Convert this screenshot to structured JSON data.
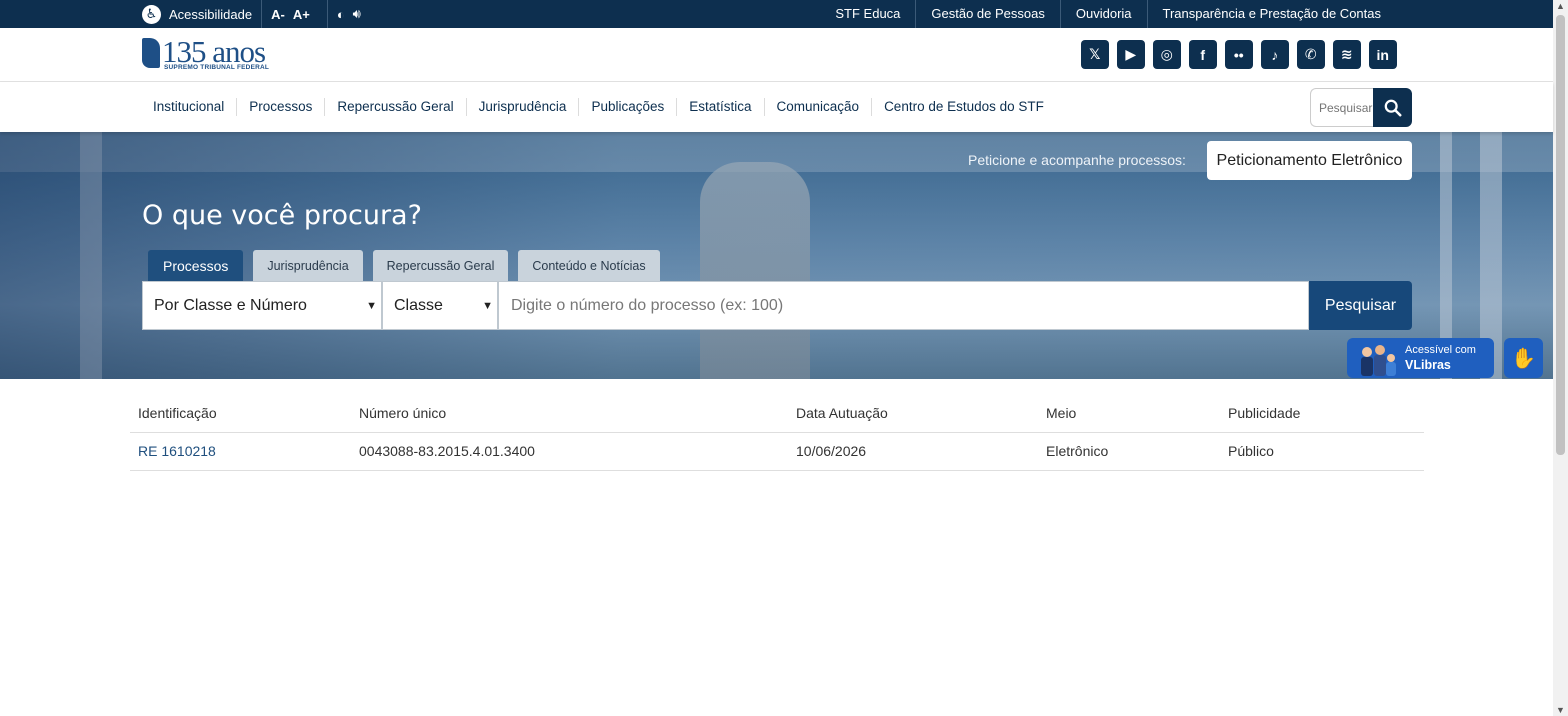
{
  "topbar": {
    "accessibility_label": "Acessibilidade",
    "font_decrease": "A-",
    "font_increase": "A+",
    "contrast_icon": "contrast-icon",
    "audio_icon": "speaker-icon",
    "links": [
      "STF Educa",
      "Gestão de Pessoas",
      "Ouvidoria",
      "Transparência e Prestação de Contas"
    ]
  },
  "header": {
    "logo_number": "135 anos",
    "logo_subtitle": "SUPREMO TRIBUNAL FEDERAL",
    "social": [
      {
        "name": "x-icon",
        "glyph": "𝕏"
      },
      {
        "name": "youtube-icon",
        "glyph": "▶"
      },
      {
        "name": "instagram-icon",
        "glyph": "◎"
      },
      {
        "name": "facebook-icon",
        "glyph": "f"
      },
      {
        "name": "flickr-icon",
        "glyph": "••"
      },
      {
        "name": "tiktok-icon",
        "glyph": "♪"
      },
      {
        "name": "whatsapp-icon",
        "glyph": "✆"
      },
      {
        "name": "spotify-icon",
        "glyph": "≋"
      },
      {
        "name": "linkedin-icon",
        "glyph": "in"
      }
    ]
  },
  "nav": {
    "items": [
      "Institucional",
      "Processos",
      "Repercussão Geral",
      "Jurisprudência",
      "Publicações",
      "Estatística",
      "Comunicação",
      "Centro de Estudos do STF"
    ],
    "search_placeholder": "Pesquisar"
  },
  "hero": {
    "petition_label": "Peticione e acompanhe processos:",
    "petition_button": "Peticionamento Eletrônico",
    "title": "O que você procura?",
    "tabs": [
      "Processos",
      "Jurisprudência",
      "Repercussão Geral",
      "Conteúdo e Notícias"
    ],
    "select_type": "Por Classe e Número",
    "select_class": "Classe",
    "input_placeholder": "Digite o número do processo (ex: 100)",
    "search_button": "Pesquisar"
  },
  "vlibras": {
    "line1": "Acessível com",
    "line2": "VLibras"
  },
  "results": {
    "columns": [
      "Identificação",
      "Número único",
      "Data Autuação",
      "Meio",
      "Publicidade"
    ],
    "rows": [
      [
        "RE 1610218",
        "0043088-83.2015.4.01.3400",
        "10/06/2026",
        "Eletrônico",
        "Público"
      ]
    ]
  },
  "colors": {
    "navy": "#0d2f4f",
    "accent": "#1f4f7e",
    "vlibras": "#1f5fbf"
  }
}
